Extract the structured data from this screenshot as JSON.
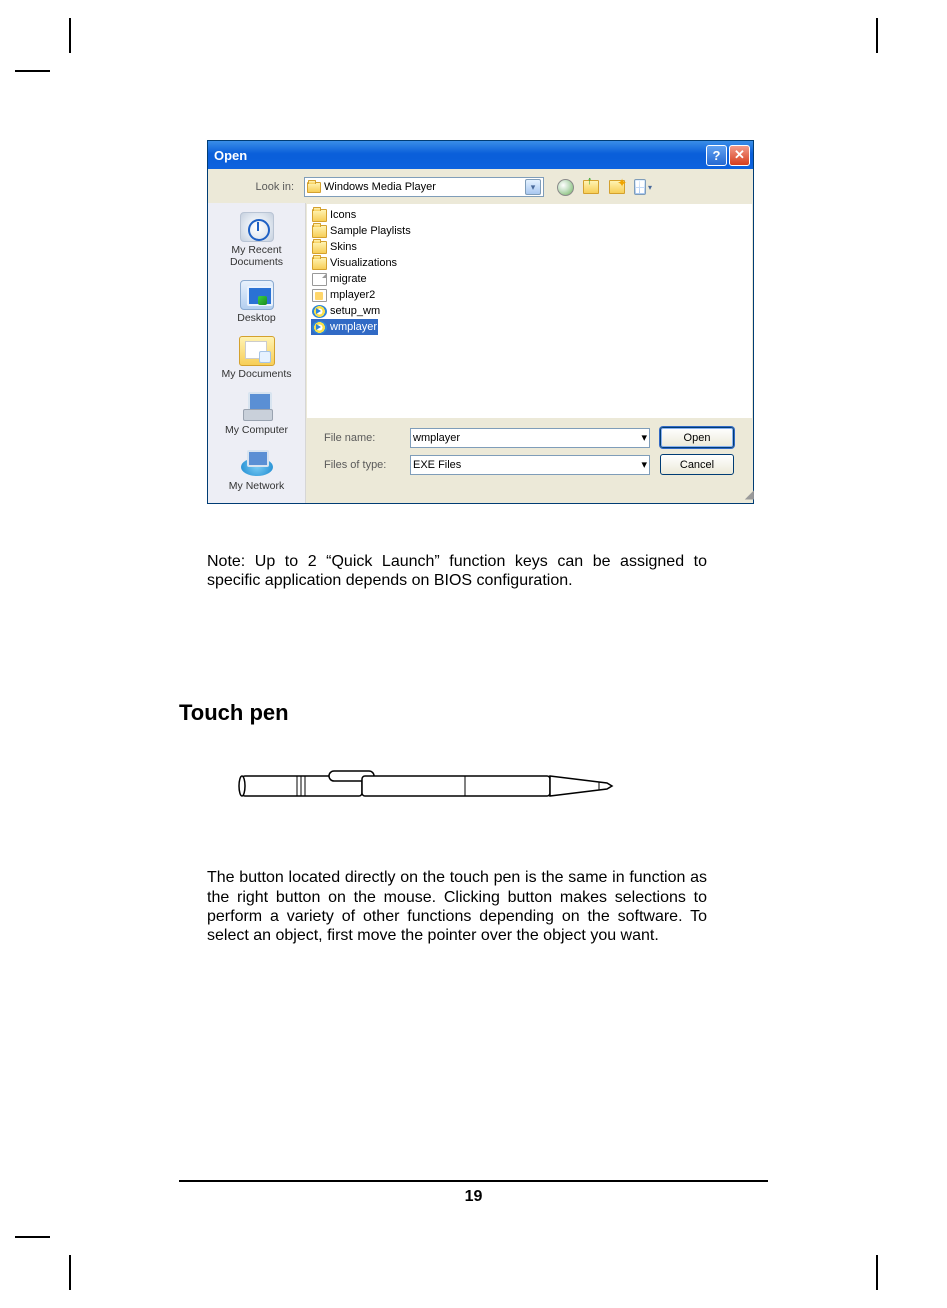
{
  "dialog": {
    "title": "Open",
    "look_in_label": "Look in:",
    "look_in_value": "Windows Media Player",
    "places": {
      "recent": "My Recent Documents",
      "desktop": "Desktop",
      "mydocs": "My Documents",
      "mycomp": "My Computer",
      "mynet": "My Network"
    },
    "files": [
      {
        "name": "Icons",
        "icon": "folder",
        "selected": false
      },
      {
        "name": "Sample Playlists",
        "icon": "folder",
        "selected": false
      },
      {
        "name": "Skins",
        "icon": "folder",
        "selected": false
      },
      {
        "name": "Visualizations",
        "icon": "folder",
        "selected": false
      },
      {
        "name": "migrate",
        "icon": "generic",
        "selected": false
      },
      {
        "name": "mplayer2",
        "icon": "ini",
        "selected": false
      },
      {
        "name": "setup_wm",
        "icon": "wmp",
        "selected": false
      },
      {
        "name": "wmplayer",
        "icon": "wmp",
        "selected": true
      }
    ],
    "file_name_label": "File name:",
    "file_name_value": "wmplayer",
    "file_type_label": "Files of type:",
    "file_type_value": "EXE Files",
    "open_btn": "Open",
    "cancel_btn": "Cancel"
  },
  "note": "Note: Up to 2 “Quick Launch” function keys can be assigned to specific application depends on BIOS configuration.",
  "heading": "Touch pen",
  "para": "The button located directly on the touch pen is the same in function as the right button on the mouse. Clicking button makes selections to perform a variety of other functions depending on the software. To select an object, first move the pointer over the object you want.",
  "page_number": "19"
}
